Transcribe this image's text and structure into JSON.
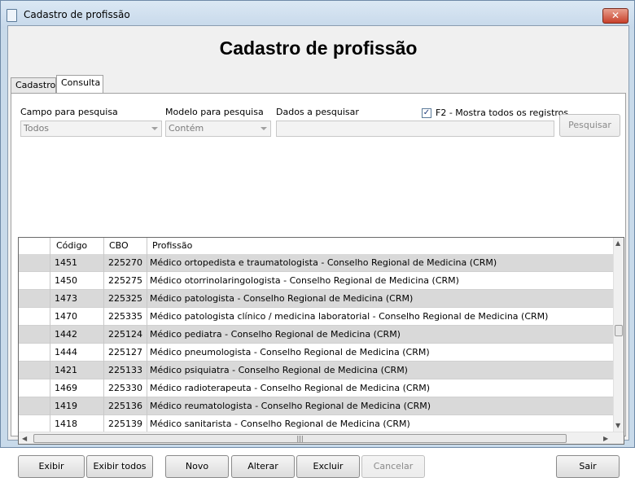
{
  "window": {
    "title": "Cadastro de profissão",
    "close_label": "✕"
  },
  "header": {
    "title": "Cadastro de profissão"
  },
  "tabs": [
    {
      "label": "Cadastro"
    },
    {
      "label": "Consulta"
    }
  ],
  "search": {
    "field_label": "Campo para pesquisa",
    "field_value": "Todos",
    "model_label": "Modelo para pesquisa",
    "model_value": "Contém",
    "data_label": "Dados a pesquisar",
    "data_value": "",
    "show_all_label": "F2 - Mostra todos os registros",
    "show_all_checked": true,
    "search_button": "Pesquisar"
  },
  "grid": {
    "columns": [
      "Código",
      "CBO",
      "Profissão"
    ],
    "rows": [
      {
        "codigo": "1451",
        "cbo": "225270",
        "profissao": "Médico ortopedista e traumatologista - Conselho Regional de Medicina (CRM)"
      },
      {
        "codigo": "1450",
        "cbo": "225275",
        "profissao": "Médico otorrinolaringologista - Conselho Regional de Medicina (CRM)"
      },
      {
        "codigo": "1473",
        "cbo": "225325",
        "profissao": "Médico patologista - Conselho Regional de Medicina (CRM)"
      },
      {
        "codigo": "1470",
        "cbo": "225335",
        "profissao": "Médico patologista clínico / medicina laboratorial - Conselho Regional de Medicina (CRM)"
      },
      {
        "codigo": "1442",
        "cbo": "225124",
        "profissao": "Médico pediatra - Conselho Regional de Medicina (CRM)"
      },
      {
        "codigo": "1444",
        "cbo": "225127",
        "profissao": "Médico pneumologista - Conselho Regional de Medicina (CRM)"
      },
      {
        "codigo": "1421",
        "cbo": "225133",
        "profissao": "Médico psiquiatra - Conselho Regional de Medicina (CRM)"
      },
      {
        "codigo": "1469",
        "cbo": "225330",
        "profissao": "Médico radioterapeuta - Conselho Regional de Medicina (CRM)"
      },
      {
        "codigo": "1419",
        "cbo": "225136",
        "profissao": "Médico reumatologista - Conselho Regional de Medicina (CRM)"
      },
      {
        "codigo": "1418",
        "cbo": "225139",
        "profissao": "Médico sanitarista - Conselho Regional de Medicina (CRM)"
      }
    ]
  },
  "buttons": {
    "exibir": "Exibir",
    "exibir_todos": "Exibir todos",
    "novo": "Novo",
    "alterar": "Alterar",
    "excluir": "Excluir",
    "cancelar": "Cancelar",
    "sair": "Sair"
  }
}
